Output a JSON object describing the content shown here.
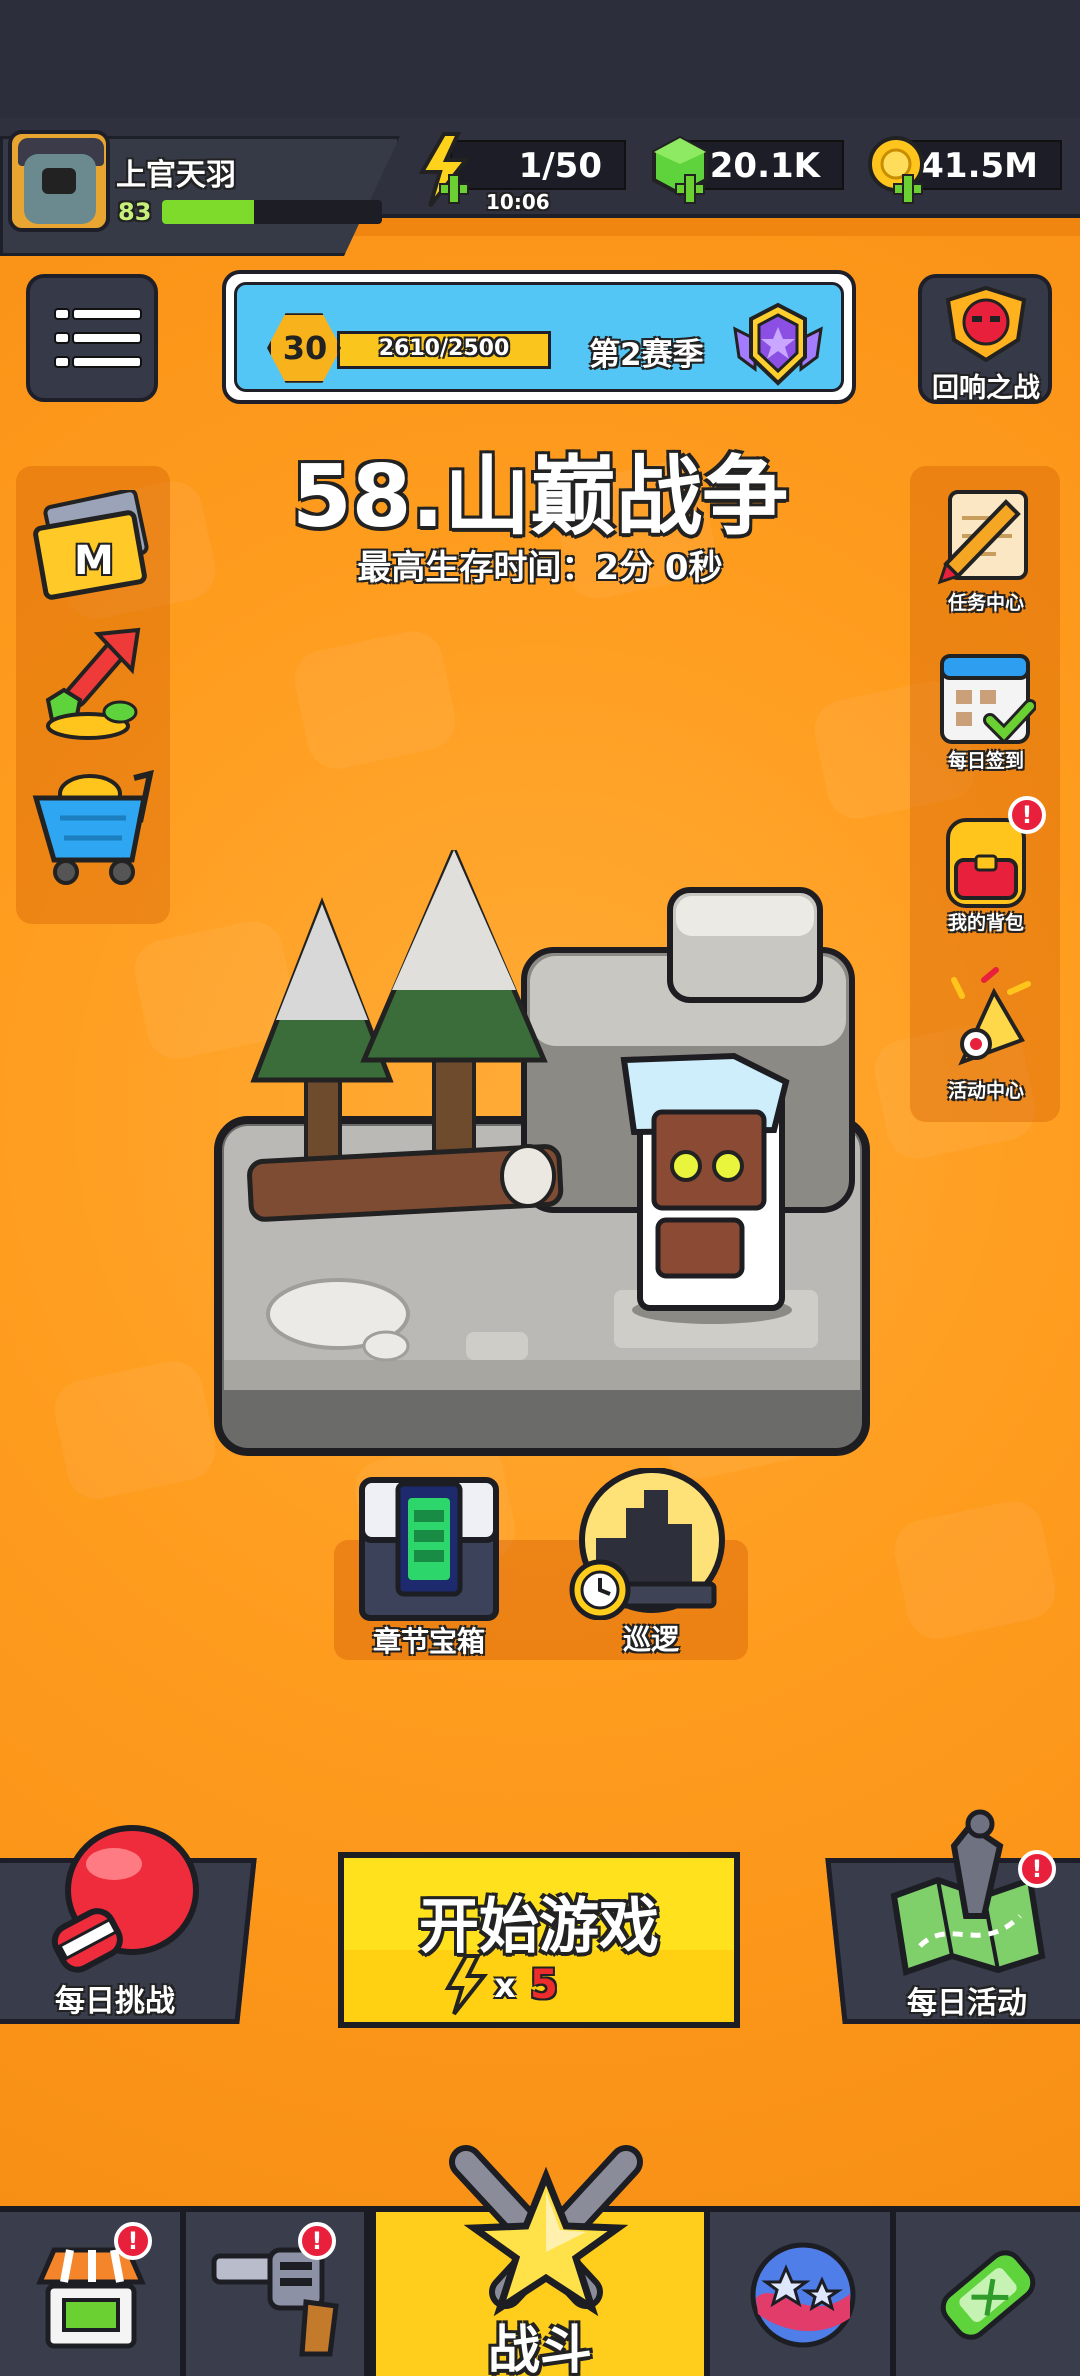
{
  "player": {
    "name": "上官天羽",
    "level": "83",
    "xp_fraction": 0.42
  },
  "resources": {
    "energy": "1/50",
    "energy_timer": "10:06",
    "gems": "20.1K",
    "gold": "41.5M"
  },
  "season": {
    "level": "30",
    "progress": "2610/2500",
    "name": "第2赛季"
  },
  "echo_battle": {
    "label": "回响之战"
  },
  "stage": {
    "title": "58.山巅战争",
    "best_time": "最高生存时间：2分 0秒"
  },
  "left_shortcuts": {
    "vip_letter": "M"
  },
  "right_shortcuts": {
    "tasks": "任务中心",
    "daily_checkin": "每日签到",
    "backpack": "我的背包",
    "events": "活动中心"
  },
  "chapter": {
    "chest_label": "章节宝箱",
    "patrol_label": "巡逻"
  },
  "start": {
    "label": "开始游戏",
    "multiplier": "x",
    "cost": "5"
  },
  "daily_challenge": {
    "label": "每日挑战"
  },
  "daily_activity": {
    "label": "每日活动"
  },
  "nav": {
    "battle": "战斗"
  },
  "badge_mark": "!",
  "colors": {
    "background": "#ff9d1f",
    "start_button": "#ffe21d",
    "nav_active": "#ffcd1b",
    "badge": "#e8203b"
  }
}
